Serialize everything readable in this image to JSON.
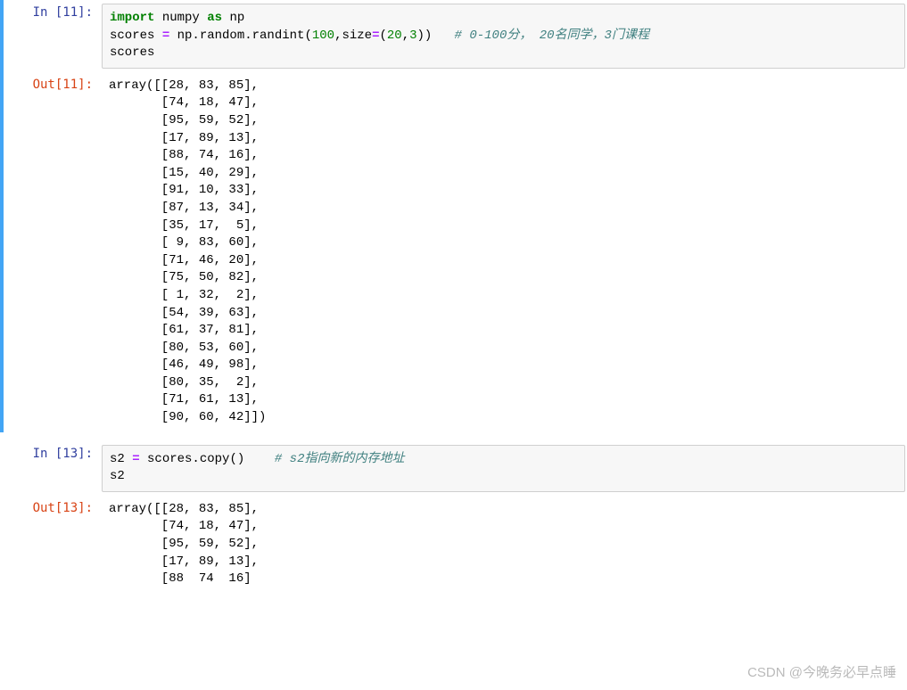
{
  "cell1": {
    "in_prompt": "In  [11]:",
    "out_prompt": "Out[11]:",
    "code_line1_import": "import",
    "code_line1_numpy": " numpy ",
    "code_line1_as": "as",
    "code_line1_np": " np",
    "code_line2_pre": "scores ",
    "code_line2_eq": "=",
    "code_line2_call": " np.random.randint(",
    "code_line2_n1": "100",
    "code_line2_comma": ",size",
    "code_line2_eq2": "=",
    "code_line2_paren": "(",
    "code_line2_n2": "20",
    "code_line2_c2": ",",
    "code_line2_n3": "3",
    "code_line2_close": "))   ",
    "code_line2_comment": "# 0-100分， 20名同学，3门课程",
    "code_line3": "scores",
    "output": "array([[28, 83, 85],\n       [74, 18, 47],\n       [95, 59, 52],\n       [17, 89, 13],\n       [88, 74, 16],\n       [15, 40, 29],\n       [91, 10, 33],\n       [87, 13, 34],\n       [35, 17,  5],\n       [ 9, 83, 60],\n       [71, 46, 20],\n       [75, 50, 82],\n       [ 1, 32,  2],\n       [54, 39, 63],\n       [61, 37, 81],\n       [80, 53, 60],\n       [46, 49, 98],\n       [80, 35,  2],\n       [71, 61, 13],\n       [90, 60, 42]])"
  },
  "cell2": {
    "in_prompt": "In  [13]:",
    "out_prompt": "Out[13]:",
    "code_line1_pre": "s2 ",
    "code_line1_eq": "=",
    "code_line1_call": " scores.copy()    ",
    "code_line1_comment": "# s2指向新的内存地址",
    "code_line2": "s2",
    "output": "array([[28, 83, 85],\n       [74, 18, 47],\n       [95, 59, 52],\n       [17, 89, 13],\n       [88  74  16]"
  },
  "watermark": "CSDN @今晚务必早点睡"
}
